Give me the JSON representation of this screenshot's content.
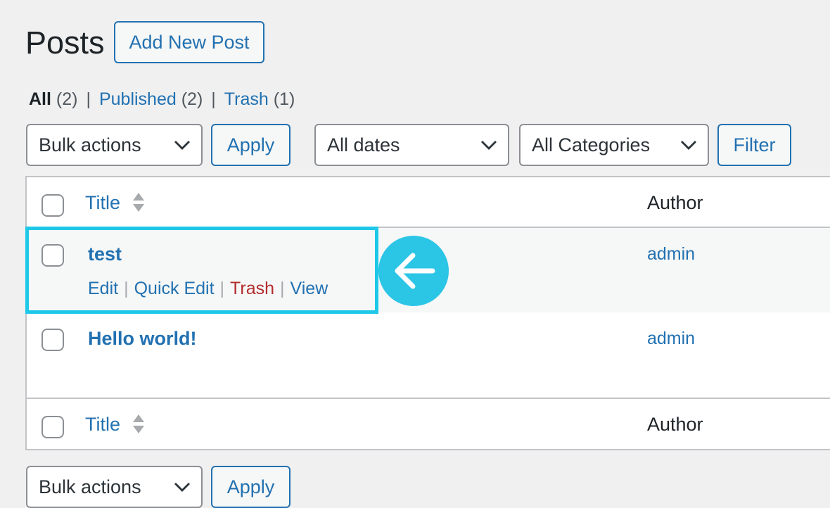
{
  "header": {
    "title": "Posts",
    "add_new_label": "Add New Post"
  },
  "views": {
    "all_label": "All",
    "all_count": "(2)",
    "published_label": "Published",
    "published_count": "(2)",
    "trash_label": "Trash",
    "trash_count": "(1)",
    "separator": "|"
  },
  "top_nav": {
    "bulk_actions": "Bulk actions",
    "apply_label": "Apply",
    "dates_filter": "All dates",
    "categories_filter": "All Categories",
    "filter_label": "Filter"
  },
  "table": {
    "columns": {
      "title": "Title",
      "author": "Author"
    },
    "rows": [
      {
        "title": "test",
        "author": "admin"
      },
      {
        "title": "Hello world!",
        "author": "admin"
      }
    ],
    "row_actions": {
      "edit": "Edit",
      "quick_edit": "Quick Edit",
      "trash": "Trash",
      "view": "View",
      "separator": "|"
    }
  },
  "bottom_nav": {
    "bulk_actions": "Bulk actions",
    "apply_label": "Apply"
  },
  "colors": {
    "link": "#2271b1",
    "trash": "#b32d2e",
    "highlight": "#1ec8e8",
    "background": "#f0f0f1"
  },
  "icons": {
    "dropdown": "chevron-down-icon",
    "sort": "sort-indicator-icon",
    "callout": "arrow-left-icon"
  }
}
